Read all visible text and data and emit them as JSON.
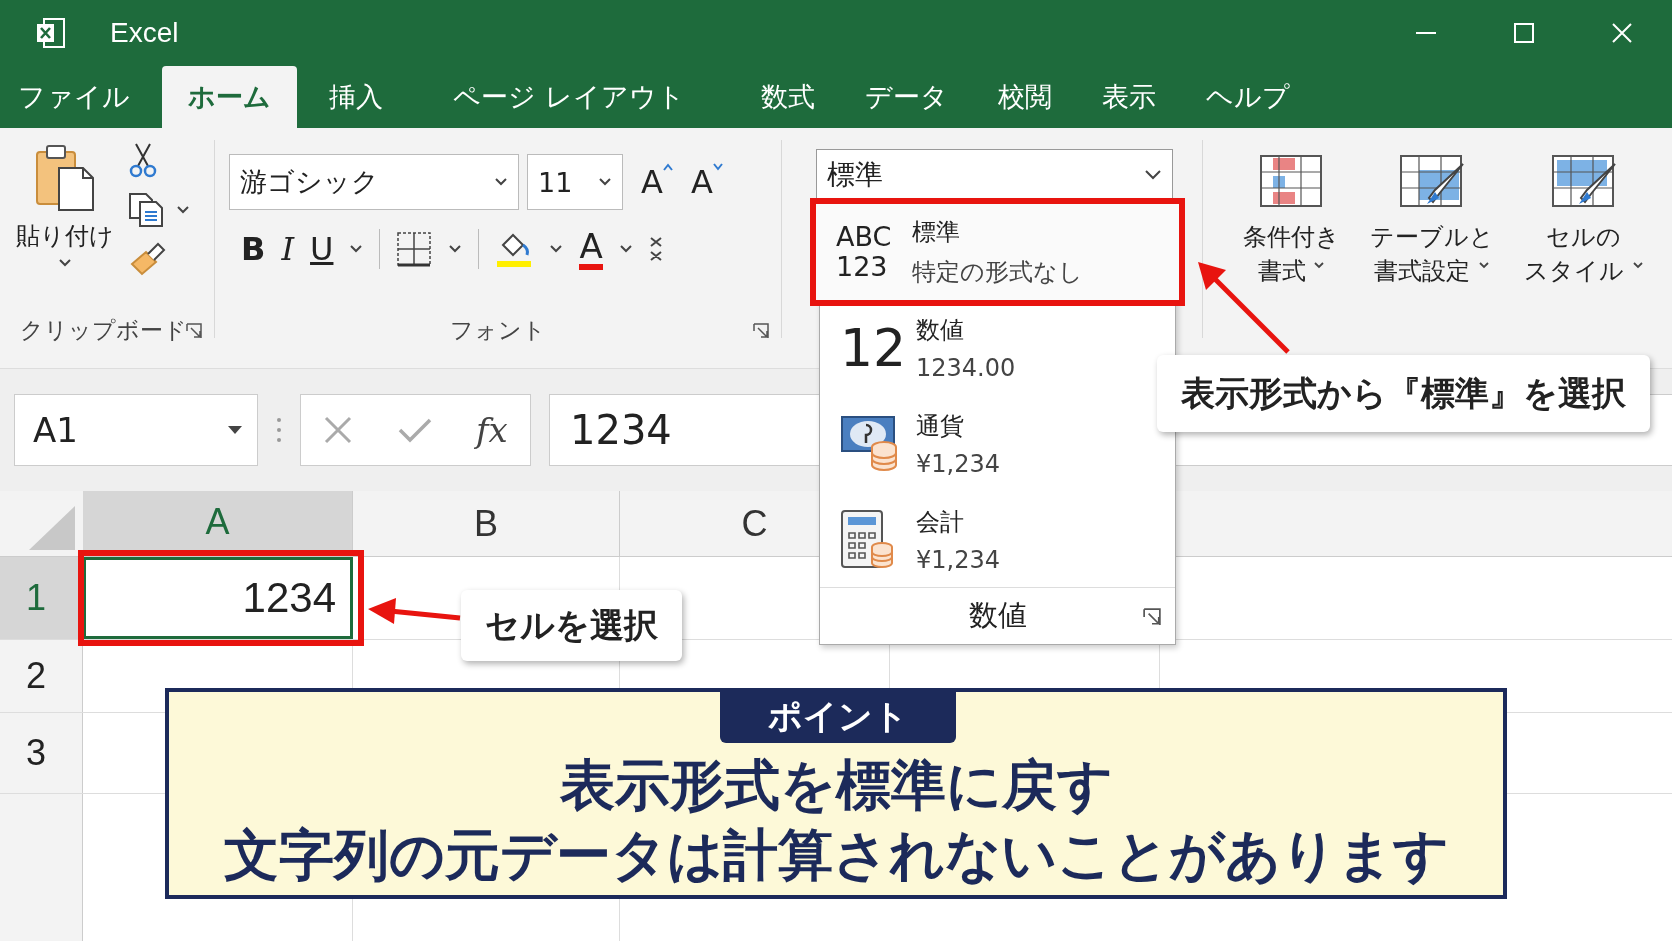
{
  "window": {
    "title": "Excel"
  },
  "tabs": [
    {
      "label": "ファイル",
      "selected": false
    },
    {
      "label": "ホーム",
      "selected": true
    },
    {
      "label": "挿入",
      "selected": false
    },
    {
      "label": "ページ レイアウト",
      "selected": false
    },
    {
      "label": "数式",
      "selected": false
    },
    {
      "label": "データ",
      "selected": false
    },
    {
      "label": "校閲",
      "selected": false
    },
    {
      "label": "表示",
      "selected": false
    },
    {
      "label": "ヘルプ",
      "selected": false
    }
  ],
  "ribbon": {
    "clipboard": {
      "paste_label": "貼り付け",
      "group_label": "クリップボード"
    },
    "font": {
      "font_name": "游ゴシック",
      "font_size": "11",
      "grow_font": "A",
      "shrink_font": "A",
      "bold": "B",
      "italic": "I",
      "underline": "U",
      "font_color": "A",
      "group_label": "フォント"
    },
    "number_format": {
      "value": "標準"
    },
    "styles": [
      {
        "line1": "条件付き",
        "line2": "書式"
      },
      {
        "line1": "テーブルと",
        "line2": "書式設定"
      },
      {
        "line1": "セルの",
        "line2": "スタイル"
      }
    ]
  },
  "formula_bar": {
    "name_box": "A1",
    "fx": "fx",
    "value": "1234"
  },
  "sheet": {
    "columns": [
      {
        "label": "A",
        "selected": true
      },
      {
        "label": "B",
        "selected": false
      },
      {
        "label": "C",
        "selected": false
      }
    ],
    "rows": [
      {
        "label": "1",
        "selected": true,
        "value": "1234"
      },
      {
        "label": "2",
        "selected": false
      },
      {
        "label": "3",
        "selected": false
      }
    ]
  },
  "format_menu": {
    "items": [
      {
        "kind": "general",
        "icon_line1": "ABC",
        "icon_line2": "123",
        "name": "標準",
        "example": "特定の形式なし",
        "selected": true
      },
      {
        "kind": "number",
        "icon_line1": "12",
        "name": "数値",
        "example": "1234.00",
        "selected": false
      },
      {
        "kind": "currency",
        "name": "通貨",
        "example": "¥1,234",
        "selected": false
      },
      {
        "kind": "accounting",
        "name": "会計",
        "example": "¥1,234",
        "selected": false
      }
    ],
    "footer": "数値"
  },
  "annotations": [
    {
      "text": "表示形式から『標準』を選択"
    },
    {
      "text": "セルを選択"
    }
  ],
  "point_box": {
    "badge": "ポイント",
    "lines": [
      "表示形式を標準に戻す",
      "文字列の元データは計算されないことがあります"
    ]
  }
}
